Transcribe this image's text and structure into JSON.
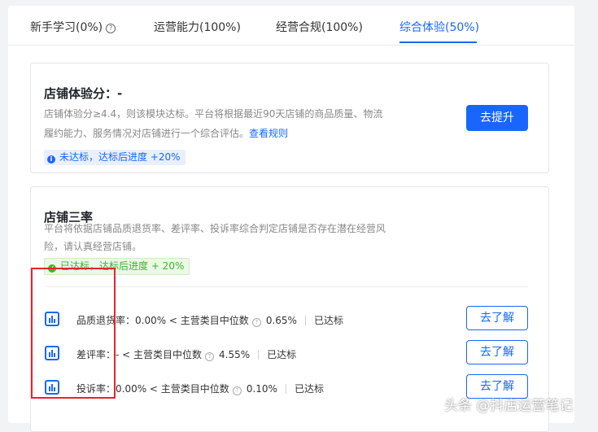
{
  "tabs": [
    {
      "label": "新手学习(0%)"
    },
    {
      "label": "运营能力(100%)"
    },
    {
      "label": "经营合规(100%)"
    },
    {
      "label": "综合体验(50%)",
      "active": true
    }
  ],
  "store_score": {
    "title": "店铺体验分：-",
    "desc_line1": "店铺体验分≥4.4，则该模块达标。平台将根据最近90天店铺的商品质量、物流",
    "desc_line2": "履约能力、服务情况对店铺进行一个综合评估。",
    "link": "查看规则",
    "badge": "未达标，达标后进度 +20%",
    "button": "去提升"
  },
  "store_rates": {
    "title": "店铺三率",
    "desc_line1": "平台将依据店铺品质退货率、差评率、投诉率综合判定店铺是否存在潜在经营风",
    "desc_line2": "险，请认真经营店铺。",
    "badge": "已达标，达标后进度 + 20%",
    "metrics": [
      {
        "label": "品质退货率：0.00% < 主营类目中位数",
        "median": "0.65%",
        "status": "已达标",
        "button": "去了解"
      },
      {
        "label": "差评率：- < 主营类目中位数",
        "median": "4.55%",
        "status": "已达标",
        "button": "去了解"
      },
      {
        "label": "投诉率：0.00% < 主营类目中位数",
        "median": "0.10%",
        "status": "已达标",
        "button": "去了解"
      }
    ]
  },
  "watermark": "头条 @抖店运营笔记",
  "colors": {
    "accent": "#1966ff",
    "success": "#3cb42f",
    "highlight": "#e5252c"
  }
}
